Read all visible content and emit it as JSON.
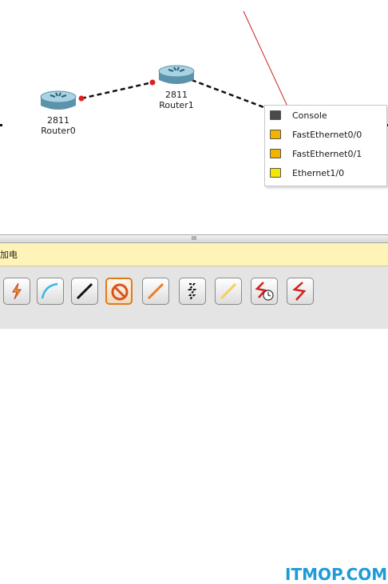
{
  "devices": [
    {
      "model": "2811",
      "name": "Router0",
      "icon": "router-icon"
    },
    {
      "model": "2811",
      "name": "Router1",
      "icon": "router-icon"
    }
  ],
  "port_menu": {
    "items": [
      {
        "label": "Console",
        "icon": "console-port-icon",
        "color": "#4a4a4a"
      },
      {
        "label": "FastEthernet0/0",
        "icon": "fastethernet-port-icon",
        "color": "#f0b400"
      },
      {
        "label": "FastEthernet0/1",
        "icon": "fastethernet-port-icon",
        "color": "#f0b400"
      },
      {
        "label": "Ethernet1/0",
        "icon": "ethernet-port-icon",
        "color": "#f5e600"
      }
    ]
  },
  "splitter": {
    "grip": "III"
  },
  "status_bar": {
    "text": "加电"
  },
  "toolbar": {
    "tools": [
      {
        "icon": "auto-connection-icon"
      },
      {
        "icon": "console-cable-icon"
      },
      {
        "icon": "copper-straight-through-icon"
      },
      {
        "icon": "copper-cross-over-icon",
        "selected": true
      },
      {
        "icon": "fiber-icon"
      },
      {
        "icon": "phone-cable-icon"
      },
      {
        "icon": "coaxial-icon"
      },
      {
        "icon": "serial-dce-icon"
      },
      {
        "icon": "serial-dte-icon"
      }
    ]
  },
  "watermark": "ITMOP.COM",
  "colors": {
    "link_endpoint": "#e02020",
    "cable": "#111111",
    "annotation_arrow": "#cc2222",
    "status_bg": "#fff4b8",
    "selected_tool": "#e07b1a"
  }
}
